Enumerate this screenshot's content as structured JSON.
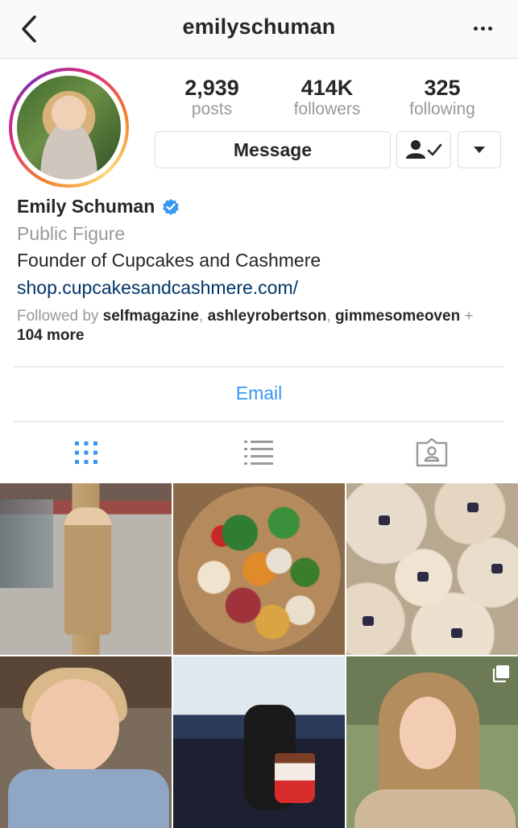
{
  "header": {
    "username": "emilyschuman",
    "back_icon": "chevron-left-icon",
    "more_icon": "ellipsis-icon"
  },
  "profile": {
    "stats": [
      {
        "value": "2,939",
        "label": "posts"
      },
      {
        "value": "414K",
        "label": "followers"
      },
      {
        "value": "325",
        "label": "following"
      }
    ],
    "message_label": "Message",
    "following_icon": "person-check-icon",
    "dropdown_icon": "caret-down-icon",
    "name": "Emily Schuman",
    "verified_icon": "verified-badge-icon",
    "category": "Public Figure",
    "bio": "Founder of Cupcakes and Cashmere",
    "link": "shop.cupcakesandcashmere.com/",
    "followed_by": {
      "prefix": "Followed by ",
      "users": [
        "selfmagazine",
        "ashleyrobertson",
        "gimmesomeoven"
      ],
      "separator": ", ",
      "plus": " + ",
      "more": "104 more"
    },
    "email_label": "Email"
  },
  "tabs": [
    {
      "icon": "grid-icon",
      "active": true
    },
    {
      "icon": "list-icon",
      "active": false
    },
    {
      "icon": "tagged-icon",
      "active": false
    }
  ],
  "colors": {
    "accent": "#3897f0",
    "link": "#003569",
    "muted": "#999999",
    "text": "#262626",
    "border": "#dbdbdb"
  }
}
